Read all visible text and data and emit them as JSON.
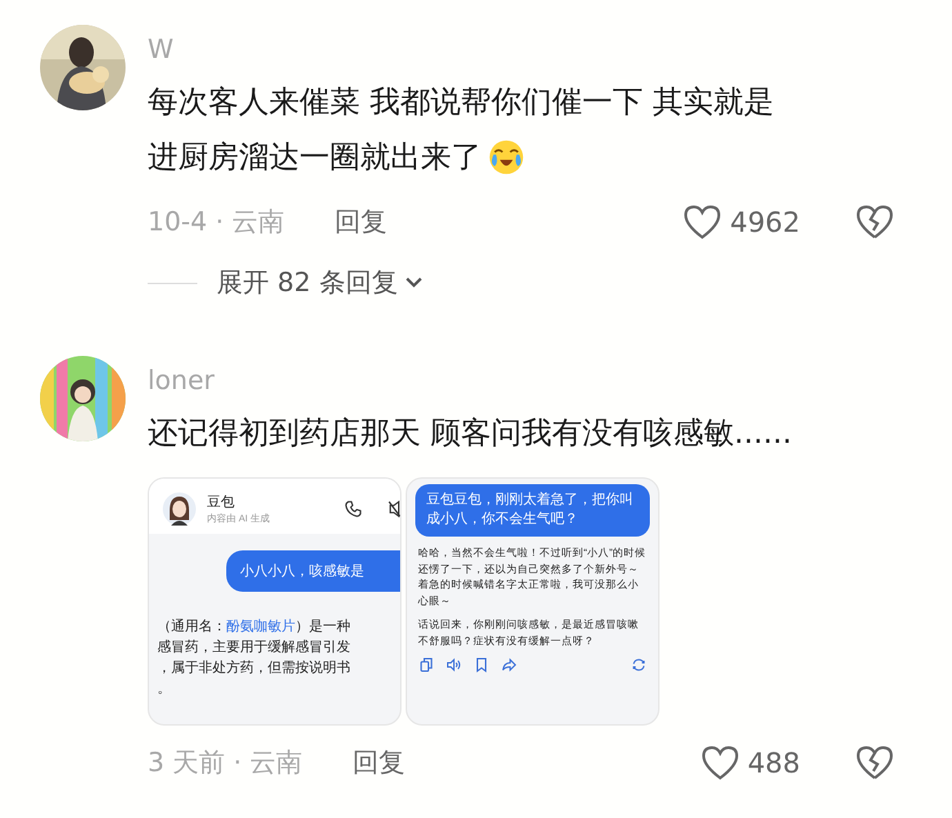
{
  "comments": [
    {
      "user": "W",
      "text_lines": [
        "每次客人来催菜 我都说帮你们催一下 其实就是",
        "进厨房溜达一圈就出来了"
      ],
      "emoji": true,
      "meta": "10-4 · 云南",
      "reply": "回复",
      "likes": "4962",
      "expand": "展开 82 条回复"
    },
    {
      "user": "loner",
      "text_lines": [
        "还记得初到药店那天 顾客问我有没有咳感敏......"
      ],
      "emoji": false,
      "meta": "3 天前 · 云南",
      "reply": "回复",
      "likes": "488",
      "screenshots": [
        {
          "kind": "chat_header",
          "bot_name": "豆包",
          "bot_note": "内容由 AI 生成",
          "user_message": "小八小八，咳感敏是",
          "reply_lines": [
            [
              "（通用名：",
              "酚氨咖敏片",
              "）是一种"
            ],
            [
              "感冒药，主要用于缓解感冒引发"
            ],
            [
              "，属于非处方药，但需按说明书"
            ],
            [
              "。"
            ]
          ]
        },
        {
          "kind": "chat_reply",
          "user_message": "豆包豆包，刚刚太着急了，把你叫成小八，你不会生气吧？",
          "reply_paragraphs": [
            "哈哈，当然不会生气啦！不过听到“小八”的时候还愣了一下，还以为自己突然多了个新外号～着急的时候喊错名字太正常啦，我可没那么小心眼～",
            "话说回来，你刚刚问咳感敏，是最近感冒咳嗽不舒服吗？症状有没有缓解一点呀？"
          ]
        }
      ]
    }
  ]
}
